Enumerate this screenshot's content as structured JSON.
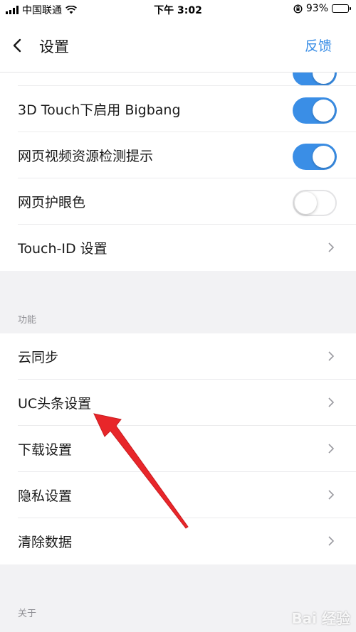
{
  "status_bar": {
    "carrier": "中国联通",
    "time": "下午 3:02",
    "battery_percent": "93%",
    "battery_level": 0.93
  },
  "nav": {
    "title": "设置",
    "feedback": "反馈"
  },
  "group1": {
    "items": [
      {
        "label": "3D Touch下启用 Bigbang",
        "control": "toggle",
        "on": true
      },
      {
        "label": "网页视频资源检测提示",
        "control": "toggle",
        "on": true
      },
      {
        "label": "网页护眼色",
        "control": "toggle",
        "on": false
      },
      {
        "label": "Touch-ID 设置",
        "control": "chevron"
      }
    ]
  },
  "section_function": {
    "label": "功能",
    "items": [
      {
        "label": "云同步"
      },
      {
        "label": "UC头条设置"
      },
      {
        "label": "下载设置"
      },
      {
        "label": "隐私设置"
      },
      {
        "label": "清除数据"
      }
    ]
  },
  "section_about": {
    "label": "关于"
  },
  "colors": {
    "accent": "#3a8ee6",
    "annotation_arrow": "#e8262a"
  },
  "watermark": "Bai 经验"
}
